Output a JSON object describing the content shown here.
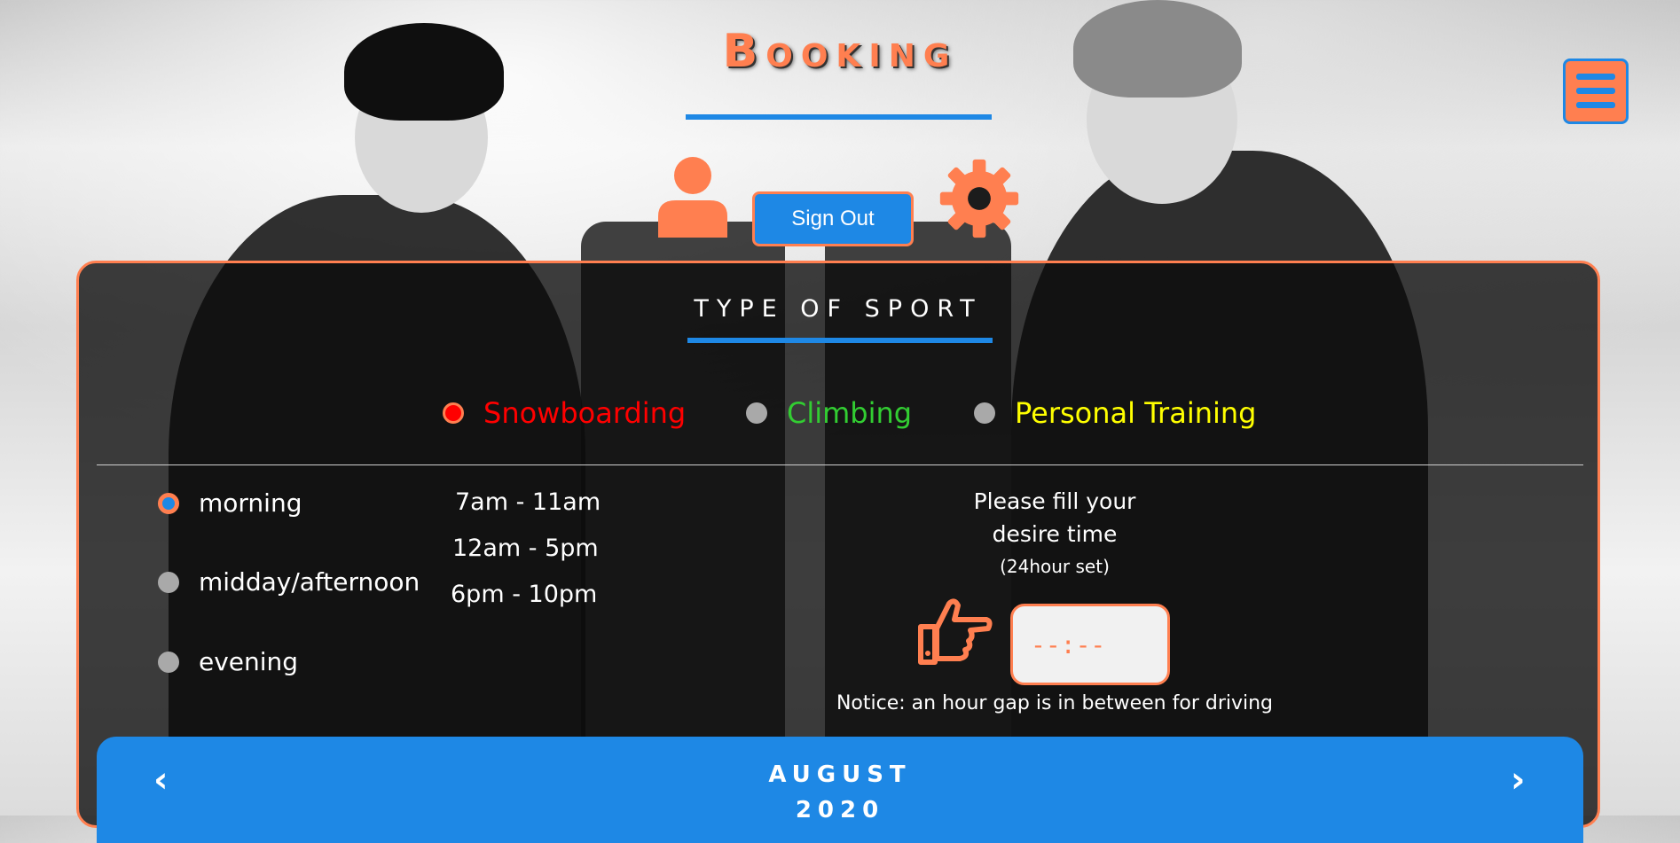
{
  "header": {
    "title": "Booking",
    "menu_icon": "hamburger-menu-icon",
    "user_icon": "user-icon",
    "sign_out_label": "Sign Out",
    "settings_icon": "gear-icon"
  },
  "sport_section": {
    "title": "TYPE OF SPORT",
    "options": [
      {
        "label": "Snowboarding",
        "color": "#ff0000",
        "selected": true
      },
      {
        "label": "Climbing",
        "color": "#32cd32",
        "selected": false
      },
      {
        "label": "Personal Training",
        "color": "#ffff00",
        "selected": false
      }
    ]
  },
  "time_section": {
    "periods": [
      {
        "label": "morning",
        "selected": true
      },
      {
        "label": "midday/afternoon",
        "selected": false
      },
      {
        "label": "evening",
        "selected": false
      }
    ],
    "ranges": [
      "7am - 11am",
      "12am - 5pm",
      "6pm - 10pm"
    ],
    "hint_line1": "Please fill your",
    "hint_line2": "desire time",
    "hint_sub": "(24hour set)",
    "pointer_icon": "hand-point-right-icon",
    "time_input_value": "--:--",
    "notice": "Notice: an hour gap is in between for driving"
  },
  "calendar": {
    "prev": "‹",
    "month": "AUGUST",
    "year": "2020",
    "next": "›"
  },
  "colors": {
    "accent_orange": "#ff7f50",
    "accent_blue": "#1e88e5"
  }
}
